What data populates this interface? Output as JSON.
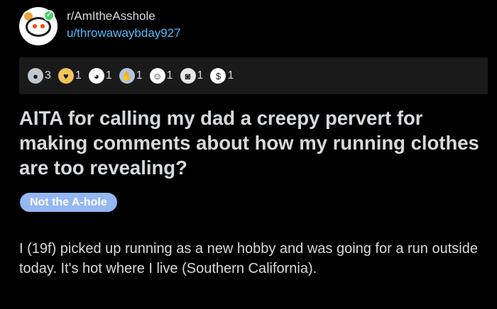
{
  "post": {
    "subreddit": "r/AmItheAsshole",
    "username": "u/throwawaybday927",
    "title": "AITA for calling my dad a creepy pervert for making comments about how my running clothes are too revealing?",
    "flair": "Not the A-hole",
    "body": "I (19f) picked up running as a new hobby and was going for a run outside today. It's hot where I live (Southern California)."
  },
  "awards": [
    {
      "icon": "silver-award-icon",
      "count": "3",
      "color": "#c0c8d0"
    },
    {
      "icon": "wholesome-award-icon",
      "count": "1",
      "color": "#f5c35b"
    },
    {
      "icon": "tearing-up-award-icon",
      "count": "1",
      "color": "#ffffff"
    },
    {
      "icon": "bless-up-award-icon",
      "count": "1",
      "color": "#b4c6e0"
    },
    {
      "icon": "hugz-award-icon",
      "count": "1",
      "color": "#ffffff"
    },
    {
      "icon": "toilet-paper-award-icon",
      "count": "1",
      "color": "#e8e8e8"
    },
    {
      "icon": "dollar-award-icon",
      "count": "1",
      "color": "#ffffff"
    }
  ]
}
